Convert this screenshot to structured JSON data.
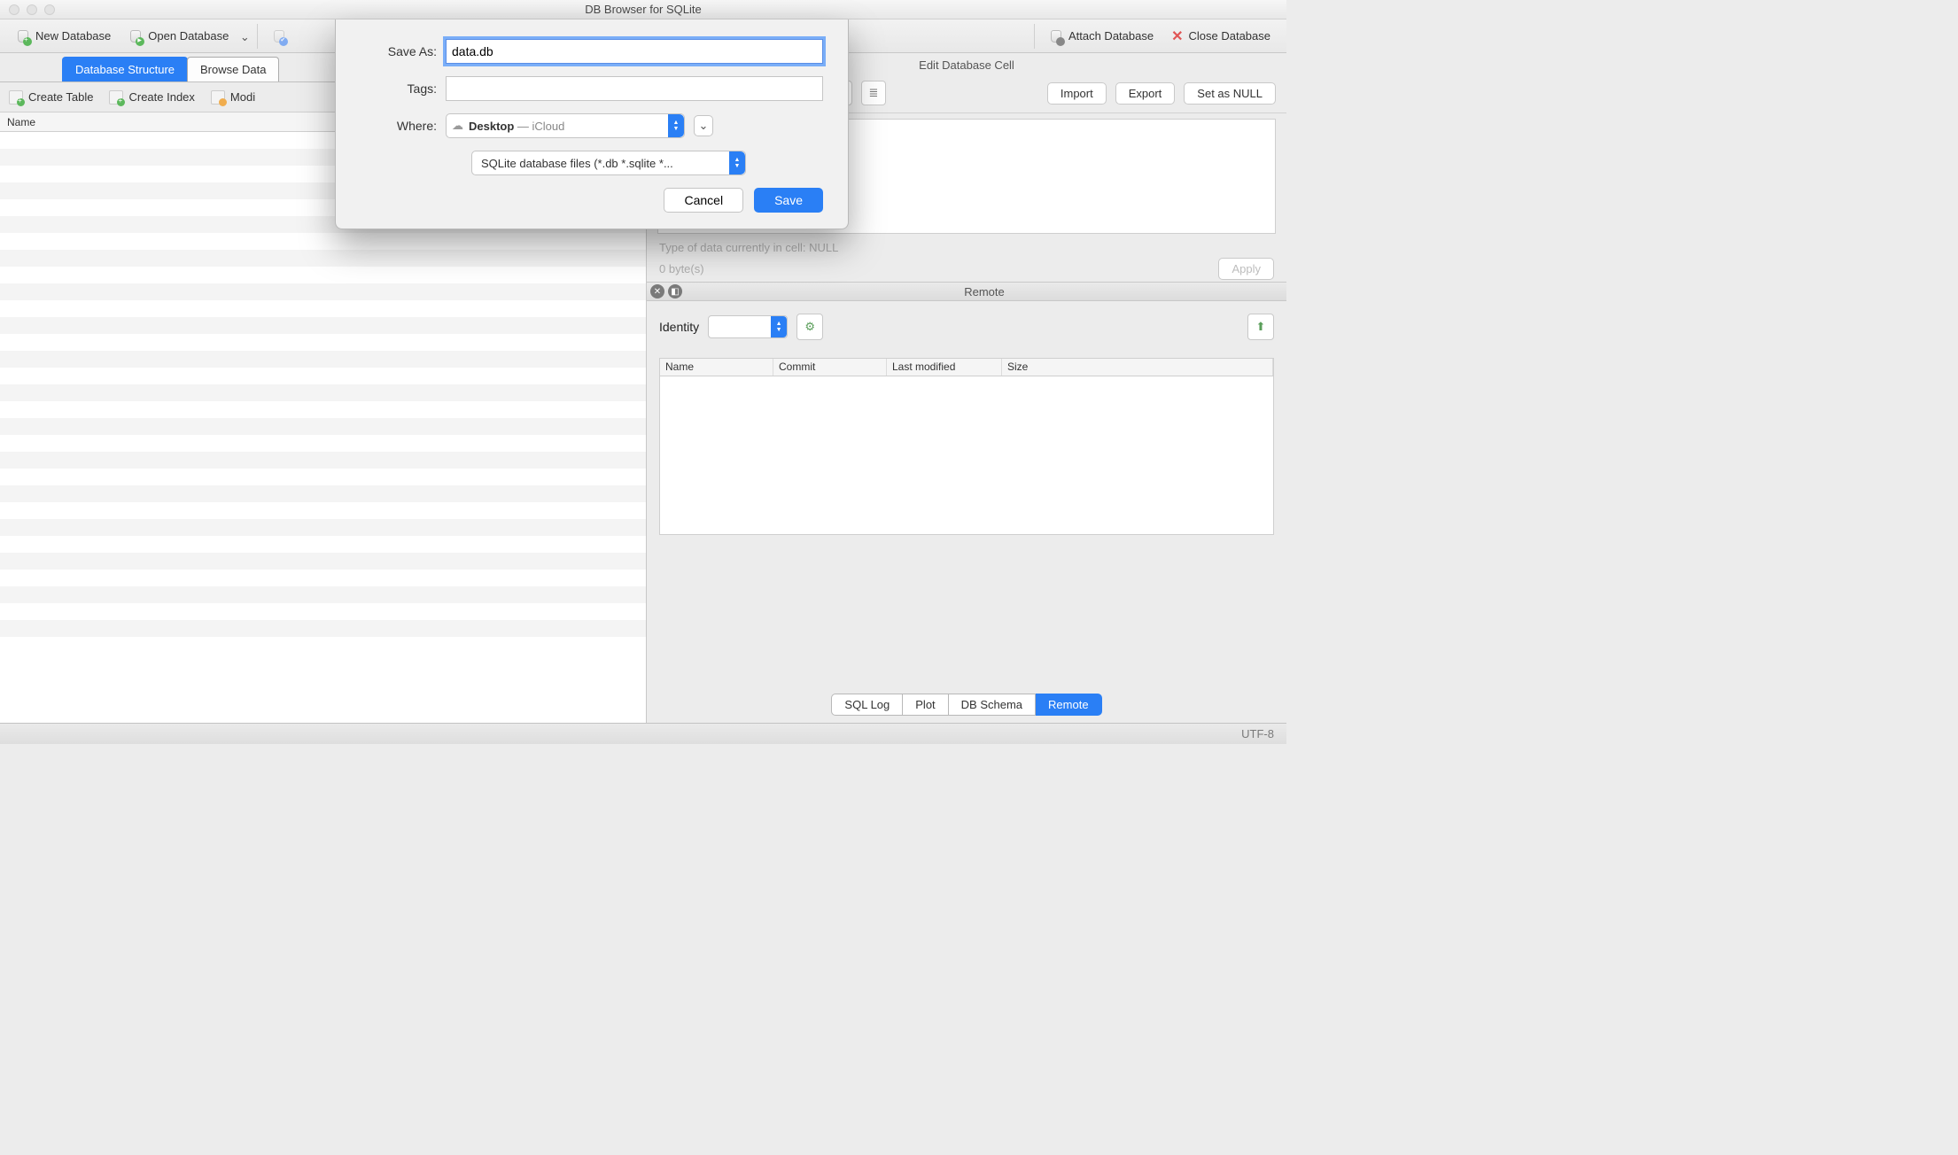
{
  "window": {
    "title": "DB Browser for SQLite"
  },
  "toolbar": {
    "new_db": "New Database",
    "open_db": "Open Database",
    "attach_db": "Attach Database",
    "close_db": "Close Database"
  },
  "tabs": {
    "structure": "Database Structure",
    "browse": "Browse Data"
  },
  "subtoolbar": {
    "create_table": "Create Table",
    "create_index": "Create Index",
    "modify": "Modi"
  },
  "columns": {
    "name": "Name"
  },
  "edit_cell": {
    "title": "Edit Database Cell",
    "import": "Import",
    "export": "Export",
    "set_null": "Set as NULL",
    "type_info": "Type of data currently in cell: NULL",
    "size_info": "0 byte(s)",
    "apply": "Apply"
  },
  "remote": {
    "title": "Remote",
    "identity_label": "Identity",
    "columns": {
      "name": "Name",
      "commit": "Commit",
      "last_modified": "Last modified",
      "size": "Size"
    }
  },
  "bottom_tabs": {
    "sql_log": "SQL Log",
    "plot": "Plot",
    "db_schema": "DB Schema",
    "remote": "Remote"
  },
  "status": {
    "encoding": "UTF-8"
  },
  "save_dialog": {
    "save_as_label": "Save As:",
    "save_as_value": "data.db",
    "tags_label": "Tags:",
    "tags_value": "",
    "where_label": "Where:",
    "where_folder": "Desktop",
    "where_suffix": " — iCloud",
    "format": "SQLite database files (*.db *.sqlite *...",
    "cancel": "Cancel",
    "save": "Save"
  }
}
